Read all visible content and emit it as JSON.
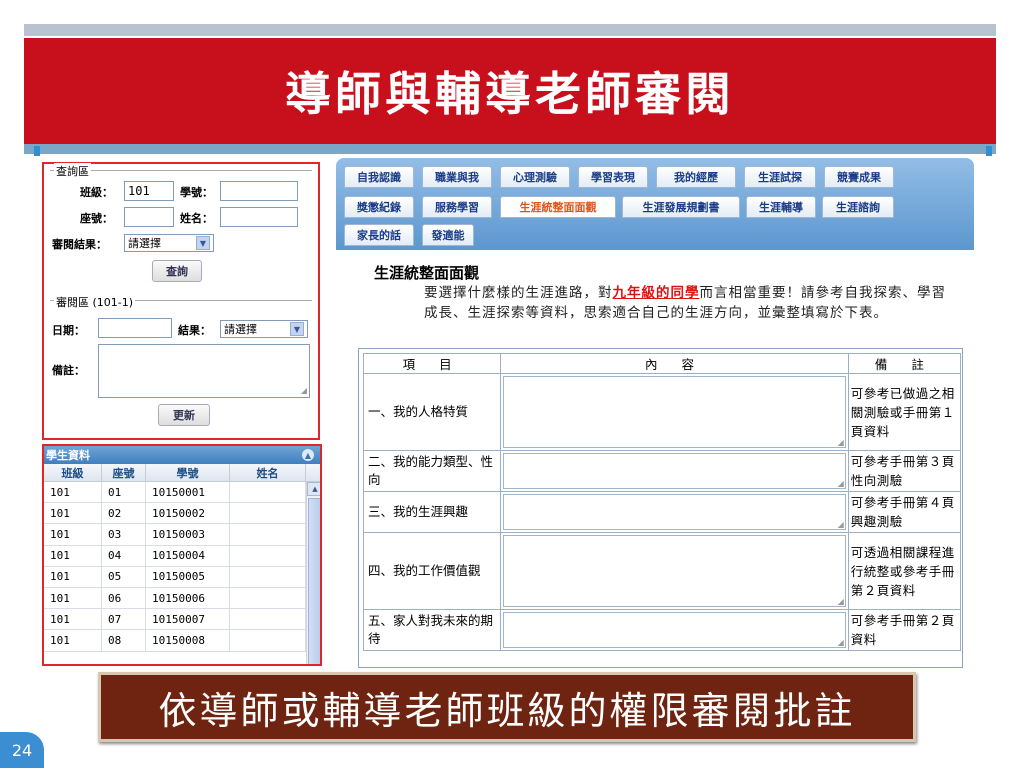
{
  "slide": {
    "title": "導師與輔導老師審閱",
    "banner": "依導師或輔導老師班級的權限審閱批註",
    "page_number": "24"
  },
  "query": {
    "section_label": "查詢區",
    "class_label": "班級：",
    "class_value": "101",
    "student_id_label": "學號：",
    "student_id_value": "",
    "seat_label": "座號：",
    "seat_value": "",
    "name_label": "姓名：",
    "name_value": "",
    "review_result_label": "審閱結果：",
    "review_result_value": "請選擇",
    "search_button": "查詢"
  },
  "review": {
    "section_label": "審閱區",
    "section_term": "(101-1)",
    "date_label": "日期：",
    "date_value": "",
    "result_label": "結果：",
    "result_value": "請選擇",
    "remark_label": "備註：",
    "update_button": "更新"
  },
  "student_grid": {
    "title": "學生資料",
    "columns": [
      "班級",
      "座號",
      "學號",
      "姓名"
    ],
    "rows": [
      [
        "101",
        "01",
        "10150001",
        ""
      ],
      [
        "101",
        "02",
        "10150002",
        ""
      ],
      [
        "101",
        "03",
        "10150003",
        ""
      ],
      [
        "101",
        "04",
        "10150004",
        ""
      ],
      [
        "101",
        "05",
        "10150005",
        ""
      ],
      [
        "101",
        "06",
        "10150006",
        ""
      ],
      [
        "101",
        "07",
        "10150007",
        ""
      ],
      [
        "101",
        "08",
        "10150008",
        ""
      ]
    ]
  },
  "tabs": [
    {
      "label": "自我認識",
      "active": false
    },
    {
      "label": "職業與我",
      "active": false
    },
    {
      "label": "心理測驗",
      "active": false
    },
    {
      "label": "學習表現",
      "active": false
    },
    {
      "label": "我的經歷",
      "active": false
    },
    {
      "label": "生涯試探",
      "active": false
    },
    {
      "label": "競賽成果",
      "active": false
    },
    {
      "label": "獎懲紀錄",
      "active": false
    },
    {
      "label": "服務學習",
      "active": false
    },
    {
      "label": "生涯統整面面觀",
      "active": true
    },
    {
      "label": "生涯發展規劃書",
      "active": false
    },
    {
      "label": "生涯輔導",
      "active": false
    },
    {
      "label": "生涯諮詢",
      "active": false
    },
    {
      "label": "家長的話",
      "active": false
    },
    {
      "label": "發適能",
      "active": false
    }
  ],
  "section": {
    "title": "生涯統整面面觀",
    "intro_before": "要選擇什麼樣的生涯進路，對",
    "intro_highlight": "九年級的同學",
    "intro_after": "而言相當重要！請參考自我探索、學習成長、生涯探索等資料，思索適合自己的生涯方向，並彙整填寫於下表。"
  },
  "table": {
    "headers": [
      "項 目",
      "內 容",
      "備 註"
    ],
    "rows": [
      {
        "item": "一、我的人格特質",
        "note": "可參考已做過之相關測驗或手冊第１頁資料"
      },
      {
        "item": "二、我的能力類型、性向",
        "note": "可參考手冊第３頁性向測驗"
      },
      {
        "item": "三、我的生涯興趣",
        "note": "可參考手冊第４頁興趣測驗"
      },
      {
        "item": "四、我的工作價值觀",
        "note": "可透過相關課程進行統整或參考手冊第２頁資料"
      },
      {
        "item": "五、家人對我未來的期待",
        "note": "可參考手冊第２頁資料"
      }
    ]
  },
  "colors": {
    "title_bar": "#c8101c",
    "highlight_border": "#e0262c",
    "tab_panel": "#5c97cf",
    "active_tab_text": "#e0541a",
    "banner": "#6e2410",
    "page_badge": "#3b8ed2"
  }
}
